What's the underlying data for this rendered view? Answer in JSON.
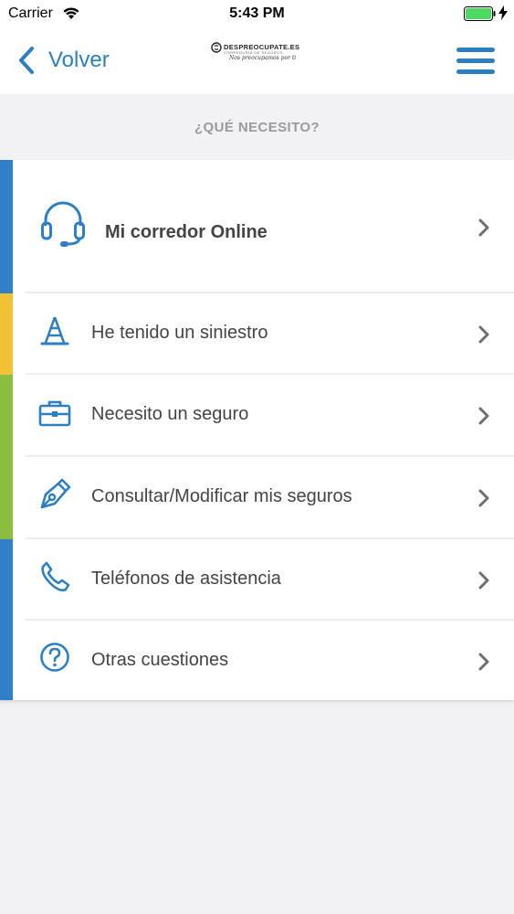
{
  "status_bar": {
    "carrier": "Carrier",
    "time": "5:43 PM",
    "battery_color": "#4cd964"
  },
  "nav": {
    "back_label": "Volver",
    "logo": {
      "brand": "DESPREOCUPATE.ES",
      "subtitle": "CORREDURÍA DE SEGUROS",
      "tagline": "Nos preocupamos por ti"
    },
    "accent": "#2e7fc0"
  },
  "section": {
    "title": "¿QUÉ NECESITO?"
  },
  "stripes": [
    {
      "color": "#2f7fc9"
    },
    {
      "color": "#f3c234"
    },
    {
      "color": "#8bbe40"
    },
    {
      "color": "#2f7fc9"
    }
  ],
  "items": [
    {
      "label": "Mi corredor Online",
      "icon": "headset-icon",
      "bold": true
    },
    {
      "label": "He tenido un siniestro",
      "icon": "traffic-cone-icon"
    },
    {
      "label": "Necesito un seguro",
      "icon": "briefcase-icon"
    },
    {
      "label": "Consultar/Modificar mis seguros",
      "icon": "pen-nib-icon"
    },
    {
      "label": "Teléfonos de asistencia",
      "icon": "phone-icon"
    },
    {
      "label": "Otras cuestiones",
      "icon": "question-icon"
    }
  ]
}
